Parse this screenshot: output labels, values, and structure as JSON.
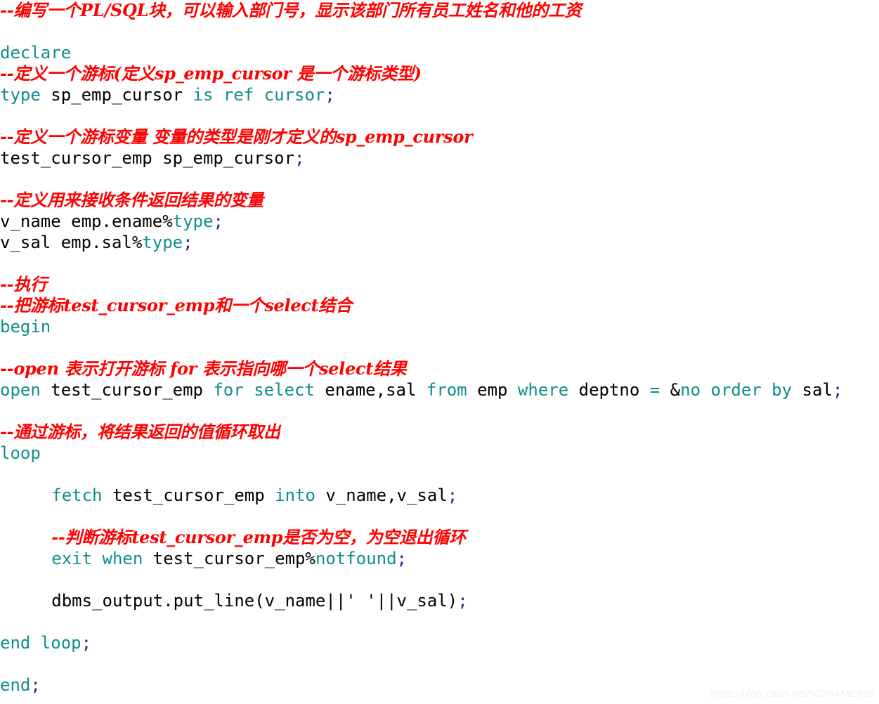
{
  "document": {
    "title": "PL/SQL cursor example code snippet",
    "language": "PL/SQL",
    "background_color": "#ffffff",
    "colors": {
      "comment": "#ff0000",
      "keyword": "#0e8e8e",
      "plain": "#000000",
      "semicolon": "#1a2a8a",
      "watermark": "#efefef"
    }
  },
  "watermark": {
    "text": "https://blog.csdn.net/NONAME999"
  },
  "code": {
    "lines": [
      {
        "id": 1,
        "indent": 0,
        "tokens": [
          {
            "t": "--编写一个PL/SQL块，可以输入部门号，显示该部门所有员工姓名和他的工资",
            "c": "comment"
          }
        ]
      },
      {
        "id": 2,
        "indent": 0,
        "tokens": []
      },
      {
        "id": 3,
        "indent": 0,
        "tokens": [
          {
            "t": "declare",
            "c": "kw"
          }
        ]
      },
      {
        "id": 4,
        "indent": 0,
        "tokens": [
          {
            "t": "--定义一个游标(定义sp_emp_cursor 是一个游标类型)",
            "c": "comment"
          }
        ]
      },
      {
        "id": 5,
        "indent": 0,
        "tokens": [
          {
            "t": "type",
            "c": "kw"
          },
          {
            "t": " sp_emp_cursor ",
            "c": "plain"
          },
          {
            "t": "is ref cursor",
            "c": "kw"
          },
          {
            "t": ";",
            "c": "semi"
          }
        ]
      },
      {
        "id": 6,
        "indent": 0,
        "tokens": []
      },
      {
        "id": 7,
        "indent": 0,
        "tokens": [
          {
            "t": "--定义一个游标变量 变量的类型是刚才定义的sp_emp_cursor",
            "c": "comment"
          }
        ]
      },
      {
        "id": 8,
        "indent": 0,
        "tokens": [
          {
            "t": "test_cursor_emp sp_emp_cursor",
            "c": "plain"
          },
          {
            "t": ";",
            "c": "semi"
          }
        ]
      },
      {
        "id": 9,
        "indent": 0,
        "tokens": []
      },
      {
        "id": 10,
        "indent": 0,
        "tokens": [
          {
            "t": "--定义用来接收条件返回结果的变量",
            "c": "comment"
          }
        ]
      },
      {
        "id": 11,
        "indent": 0,
        "tokens": [
          {
            "t": "v_name emp.ename%",
            "c": "plain"
          },
          {
            "t": "type",
            "c": "kw"
          },
          {
            "t": ";",
            "c": "semi"
          }
        ]
      },
      {
        "id": 12,
        "indent": 0,
        "tokens": [
          {
            "t": "v_sal emp.sal%",
            "c": "plain"
          },
          {
            "t": "type",
            "c": "kw"
          },
          {
            "t": ";",
            "c": "semi"
          }
        ]
      },
      {
        "id": 13,
        "indent": 0,
        "tokens": []
      },
      {
        "id": 14,
        "indent": 0,
        "tokens": [
          {
            "t": "--执行",
            "c": "comment"
          }
        ]
      },
      {
        "id": 15,
        "indent": 0,
        "tokens": [
          {
            "t": "--把游标test_cursor_emp和一个select结合",
            "c": "comment"
          }
        ]
      },
      {
        "id": 16,
        "indent": 0,
        "tokens": [
          {
            "t": "begin",
            "c": "kw"
          }
        ]
      },
      {
        "id": 17,
        "indent": 0,
        "tokens": []
      },
      {
        "id": 18,
        "indent": 0,
        "tokens": [
          {
            "t": "--open 表示打开游标 for 表示指向哪一个select结果",
            "c": "comment"
          }
        ]
      },
      {
        "id": 19,
        "indent": 0,
        "tokens": [
          {
            "t": "open",
            "c": "kw"
          },
          {
            "t": " test_cursor_emp ",
            "c": "plain"
          },
          {
            "t": "for select",
            "c": "kw"
          },
          {
            "t": " ename,sal ",
            "c": "plain"
          },
          {
            "t": "from",
            "c": "kw"
          },
          {
            "t": " emp ",
            "c": "plain"
          },
          {
            "t": "where",
            "c": "kw"
          },
          {
            "t": " deptno ",
            "c": "plain"
          },
          {
            "t": "=",
            "c": "kw"
          },
          {
            "t": " &",
            "c": "plain"
          },
          {
            "t": "no order by",
            "c": "kw"
          },
          {
            "t": " sal",
            "c": "plain"
          },
          {
            "t": ";",
            "c": "semi"
          }
        ]
      },
      {
        "id": 20,
        "indent": 0,
        "tokens": []
      },
      {
        "id": 21,
        "indent": 0,
        "tokens": [
          {
            "t": "--通过游标，将结果返回的值循环取出",
            "c": "comment"
          }
        ]
      },
      {
        "id": 22,
        "indent": 0,
        "tokens": [
          {
            "t": "loop",
            "c": "kw"
          }
        ]
      },
      {
        "id": 23,
        "indent": 0,
        "tokens": []
      },
      {
        "id": 24,
        "indent": 5,
        "tokens": [
          {
            "t": "fetch",
            "c": "kw"
          },
          {
            "t": " test_cursor_emp ",
            "c": "plain"
          },
          {
            "t": "into",
            "c": "kw"
          },
          {
            "t": " v_name,v_sal",
            "c": "plain"
          },
          {
            "t": ";",
            "c": "semi"
          }
        ]
      },
      {
        "id": 25,
        "indent": 0,
        "tokens": []
      },
      {
        "id": 26,
        "indent": 5,
        "tokens": [
          {
            "t": "--判断游标test_cursor_emp是否为空，为空退出循环",
            "c": "comment"
          }
        ]
      },
      {
        "id": 27,
        "indent": 5,
        "tokens": [
          {
            "t": "exit when",
            "c": "kw"
          },
          {
            "t": " test_cursor_emp%",
            "c": "plain"
          },
          {
            "t": "notfound",
            "c": "kw"
          },
          {
            "t": ";",
            "c": "semi"
          }
        ]
      },
      {
        "id": 28,
        "indent": 0,
        "tokens": []
      },
      {
        "id": 29,
        "indent": 5,
        "tokens": [
          {
            "t": "dbms_output.put_line(v_name||' '||v_sal)",
            "c": "plain"
          },
          {
            "t": ";",
            "c": "semi"
          }
        ]
      },
      {
        "id": 30,
        "indent": 0,
        "tokens": []
      },
      {
        "id": 31,
        "indent": 0,
        "tokens": [
          {
            "t": "end loop",
            "c": "kw"
          },
          {
            "t": ";",
            "c": "semi"
          }
        ]
      },
      {
        "id": 32,
        "indent": 0,
        "tokens": []
      },
      {
        "id": 33,
        "indent": 0,
        "tokens": [
          {
            "t": "end",
            "c": "kw"
          },
          {
            "t": ";",
            "c": "semi"
          }
        ]
      }
    ]
  }
}
